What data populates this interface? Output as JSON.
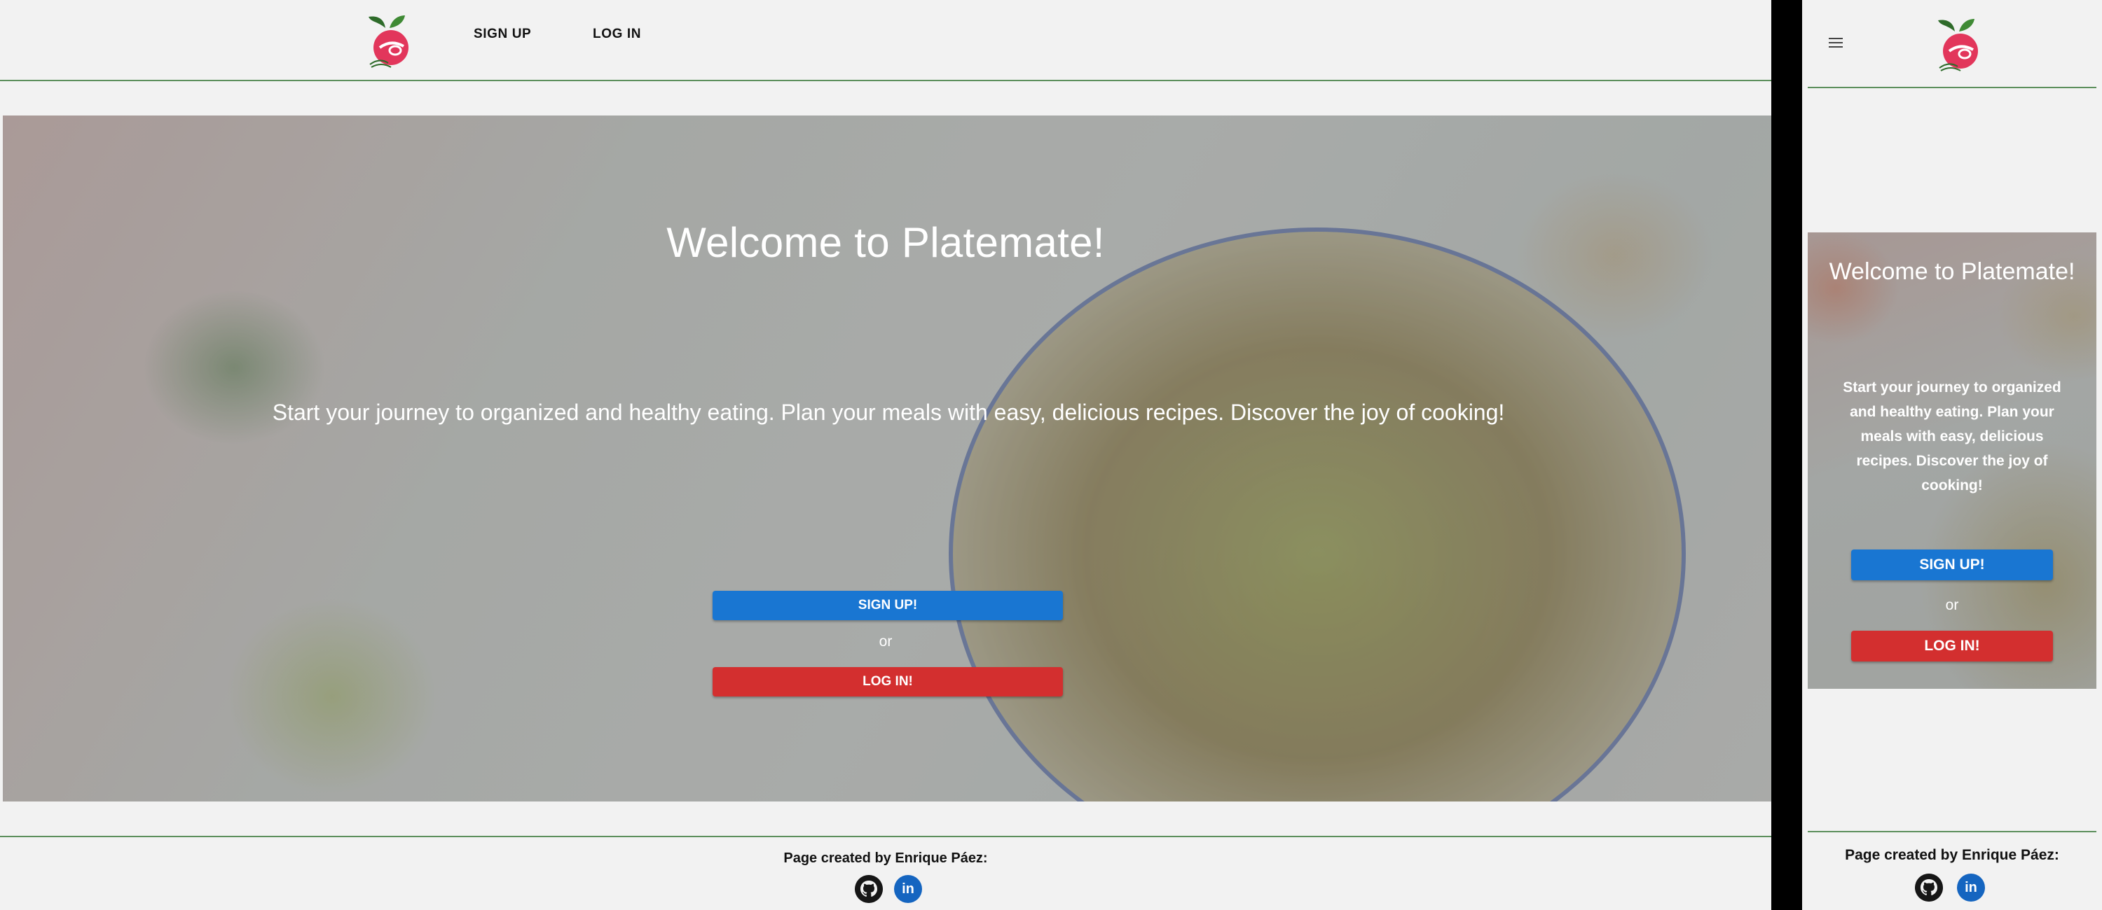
{
  "colors": {
    "accent_line": "#5c8f5c",
    "signup_button": "#1976d2",
    "login_button": "#d32f2f",
    "github": "#161616",
    "linkedin": "#1565c0",
    "divider": "#000000"
  },
  "icons": [
    "platemate-logo-icon",
    "hamburger-menu-icon",
    "github-icon",
    "linkedin-icon"
  ],
  "desktop": {
    "nav": {
      "signup": "SIGN UP",
      "login": "LOG IN"
    },
    "hero": {
      "title": "Welcome to Platemate!",
      "subtitle": "Start your journey to organized and healthy eating. Plan your meals with easy, delicious recipes. Discover the joy of cooking!",
      "signup_button": "SIGN UP!",
      "or": "or",
      "login_button": "LOG IN!"
    },
    "footer": {
      "credit": "Page created by Enrique Páez:",
      "linkedin_glyph": "in"
    }
  },
  "mobile": {
    "hero": {
      "title": "Welcome to Platemate!",
      "subtitle": "Start your journey to organized and healthy eating. Plan your meals with easy, delicious recipes. Discover the joy of cooking!",
      "signup_button": "SIGN UP!",
      "or": "or",
      "login_button": "LOG IN!"
    },
    "footer": {
      "credit": "Page created by Enrique Páez:",
      "linkedin_glyph": "in"
    }
  }
}
